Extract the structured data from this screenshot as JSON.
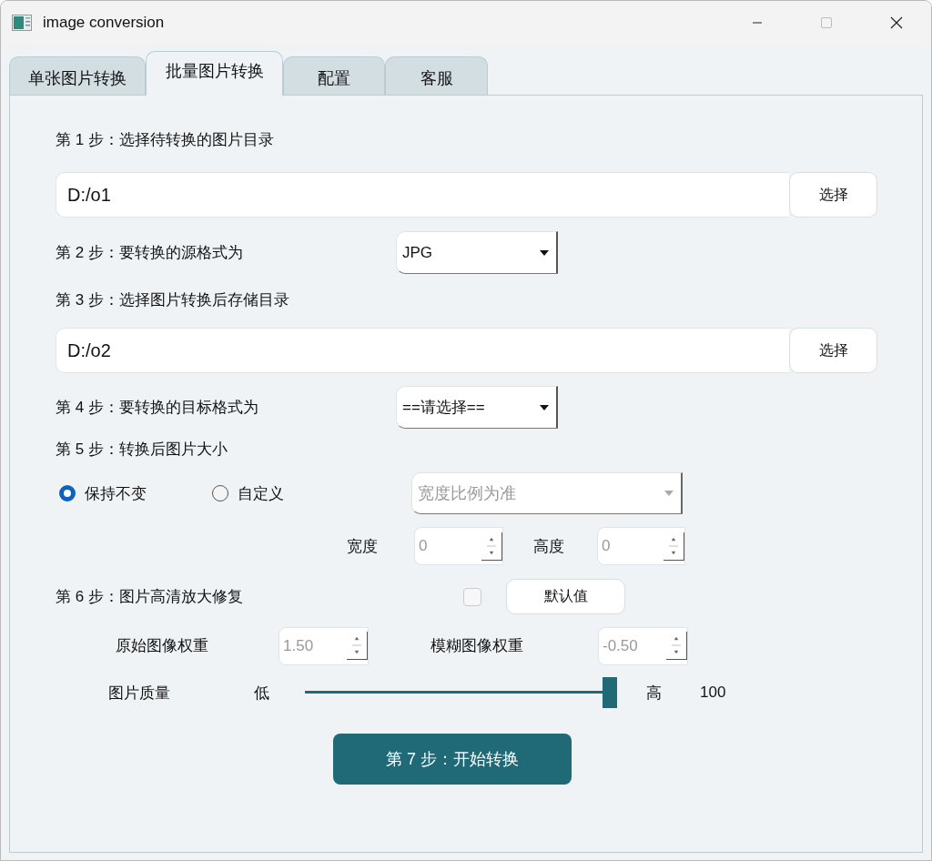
{
  "window": {
    "title": "image conversion"
  },
  "tabs": [
    {
      "label": "单张图片转换",
      "selected": false
    },
    {
      "label": "批量图片转换",
      "selected": true
    },
    {
      "label": "配置",
      "selected": false
    },
    {
      "label": "客服",
      "selected": false
    }
  ],
  "step1": {
    "label": "第 1 步：选择待转换的图片目录",
    "path": "D:/o1",
    "button": "选择"
  },
  "step2": {
    "label": "第 2 步：要转换的源格式为",
    "dropdown": {
      "value": "JPG",
      "disabled": false
    }
  },
  "step3": {
    "label": "第 3 步：选择图片转换后存储目录",
    "path": "D:/o2",
    "button": "选择"
  },
  "step4": {
    "label": "第 4 步：要转换的目标格式为",
    "dropdown": {
      "value": "==请选择==",
      "disabled": false
    }
  },
  "step5": {
    "label": "第 5 步：转换后图片大小",
    "options": [
      {
        "label": "保持不变",
        "selected": true
      },
      {
        "label": "自定义",
        "selected": false
      }
    ],
    "mode_dropdown": {
      "value": "宽度比例为准",
      "disabled": true
    },
    "width": {
      "label": "宽度",
      "value": "0",
      "disabled": true
    },
    "height": {
      "label": "高度",
      "value": "0",
      "disabled": true
    }
  },
  "step6": {
    "label": "第 6 步：图片高清放大修复",
    "enable_checkbox": {
      "checked": false
    },
    "default_button": "默认值",
    "original_weight": {
      "label": "原始图像权重",
      "value": "1.50",
      "disabled": true
    },
    "blur_weight": {
      "label": "模糊图像权重",
      "value": "-0.50",
      "disabled": true
    },
    "quality": {
      "label": "图片质量",
      "low": "低",
      "high": "高",
      "level": 1,
      "reading": "100"
    }
  },
  "start_button": "第 7 步：开始转换"
}
